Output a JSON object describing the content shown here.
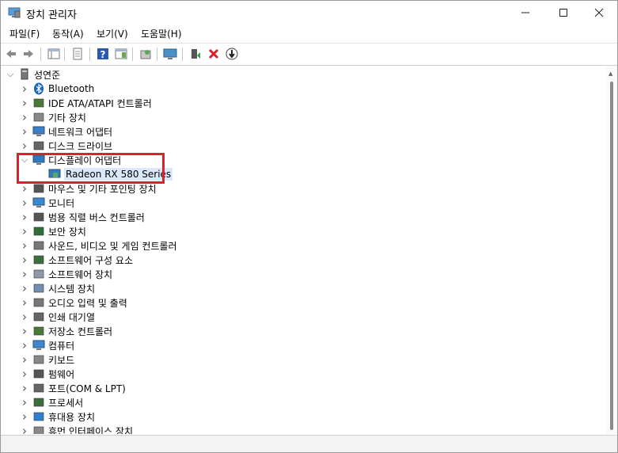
{
  "window": {
    "title": "장치 관리자"
  },
  "menu": [
    "파일(F)",
    "동작(A)",
    "보기(V)",
    "도움말(H)"
  ],
  "tree": {
    "root": "성연준",
    "categories": [
      {
        "label": "Bluetooth",
        "icon": "bluetooth-icon"
      },
      {
        "label": "IDE ATA/ATAPI 컨트롤러",
        "icon": "ide-controller-icon"
      },
      {
        "label": "기타 장치",
        "icon": "unknown-device-icon"
      },
      {
        "label": "네트워크 어댑터",
        "icon": "network-adapter-icon"
      },
      {
        "label": "디스크 드라이브",
        "icon": "disk-drive-icon"
      },
      {
        "label": "디스플레이 어댑터",
        "icon": "display-adapter-icon",
        "expanded": true,
        "children": [
          "Radeon RX 580 Series"
        ]
      },
      {
        "label": "마우스 및 기타 포인팅 장치",
        "icon": "mouse-icon"
      },
      {
        "label": "모니터",
        "icon": "monitor-icon"
      },
      {
        "label": "범용 직렬 버스 컨트롤러",
        "icon": "usb-icon"
      },
      {
        "label": "보안 장치",
        "icon": "security-device-icon"
      },
      {
        "label": "사운드, 비디오 및 게임 컨트롤러",
        "icon": "sound-icon"
      },
      {
        "label": "소프트웨어 구성 요소",
        "icon": "software-component-icon"
      },
      {
        "label": "소프트웨어 장치",
        "icon": "software-device-icon"
      },
      {
        "label": "시스템 장치",
        "icon": "system-device-icon"
      },
      {
        "label": "오디오 입력 및 출력",
        "icon": "audio-io-icon"
      },
      {
        "label": "인쇄 대기열",
        "icon": "printer-icon"
      },
      {
        "label": "저장소 컨트롤러",
        "icon": "storage-controller-icon"
      },
      {
        "label": "컴퓨터",
        "icon": "computer-icon"
      },
      {
        "label": "키보드",
        "icon": "keyboard-icon"
      },
      {
        "label": "펌웨어",
        "icon": "firmware-icon"
      },
      {
        "label": "포트(COM & LPT)",
        "icon": "port-icon"
      },
      {
        "label": "프로세서",
        "icon": "processor-icon"
      },
      {
        "label": "휴대용 장치",
        "icon": "portable-device-icon"
      },
      {
        "label": "휴먼 인터페이스 장치",
        "icon": "hid-icon"
      }
    ]
  },
  "colors": {
    "highlight_box": "#e0202e",
    "accent": "#1c5fb8"
  }
}
